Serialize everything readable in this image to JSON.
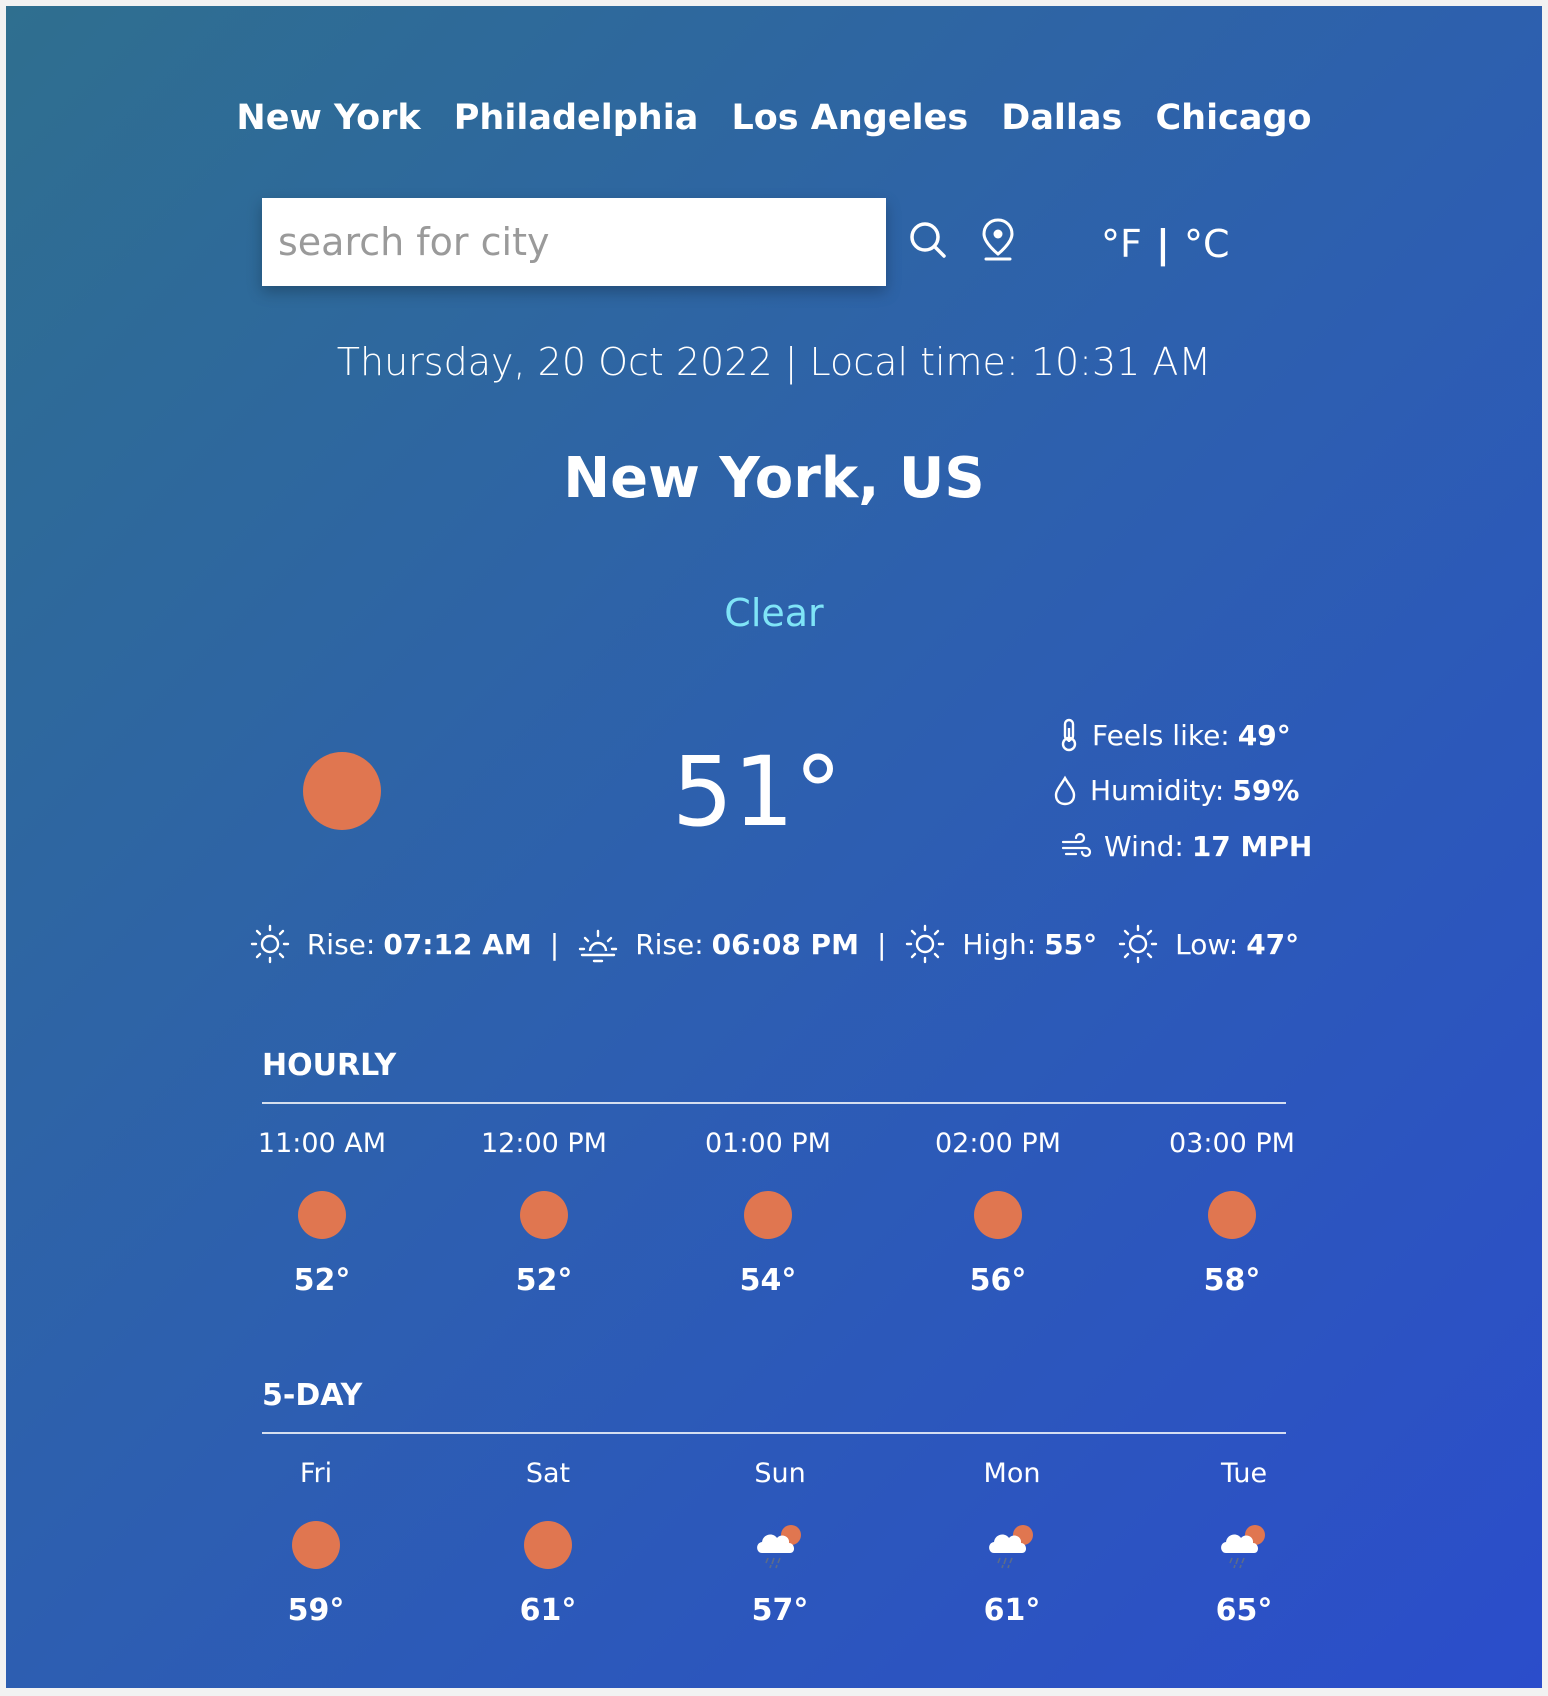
{
  "cities": [
    "New York",
    "Philadelphia",
    "Los Angeles",
    "Dallas",
    "Chicago"
  ],
  "search": {
    "placeholder": "search for city"
  },
  "units": {
    "fahrenheit": "°F",
    "separator": "|",
    "celsius": "°C"
  },
  "date_time": "Thursday, 20 Oct 2022 | Local time: 10:31 AM",
  "location": "New York, US",
  "condition": "Clear",
  "current": {
    "temp": "51°",
    "feels_like_label": "Feels like:",
    "feels_like": "49°",
    "humidity_label": "Humidity:",
    "humidity": "59%",
    "wind_label": "Wind:",
    "wind": "17 MPH"
  },
  "sun": {
    "rise_label": "Rise:",
    "rise": "07:12 AM",
    "set_label": "Rise:",
    "set": "06:08 PM",
    "high_label": "High:",
    "high": "55°",
    "low_label": "Low:",
    "low": "47°",
    "separator": "|"
  },
  "hourly": {
    "title": "HOURLY",
    "items": [
      {
        "label": "11:00 AM",
        "temp": "52°",
        "icon": "sun-icon"
      },
      {
        "label": "12:00 PM",
        "temp": "52°",
        "icon": "sun-icon"
      },
      {
        "label": "01:00 PM",
        "temp": "54°",
        "icon": "sun-icon"
      },
      {
        "label": "02:00 PM",
        "temp": "56°",
        "icon": "sun-icon"
      },
      {
        "label": "03:00 PM",
        "temp": "58°",
        "icon": "sun-icon"
      }
    ]
  },
  "daily": {
    "title": "5-DAY",
    "items": [
      {
        "label": "Fri",
        "temp": "59°",
        "icon": "sun-icon"
      },
      {
        "label": "Sat",
        "temp": "61°",
        "icon": "sun-icon"
      },
      {
        "label": "Sun",
        "temp": "57°",
        "icon": "rain-cloud-icon"
      },
      {
        "label": "Mon",
        "temp": "61°",
        "icon": "rain-cloud-icon"
      },
      {
        "label": "Tue",
        "temp": "65°",
        "icon": "rain-cloud-icon"
      }
    ]
  },
  "colors": {
    "accent_condition": "#7fe4f7",
    "sun": "#e07650"
  }
}
